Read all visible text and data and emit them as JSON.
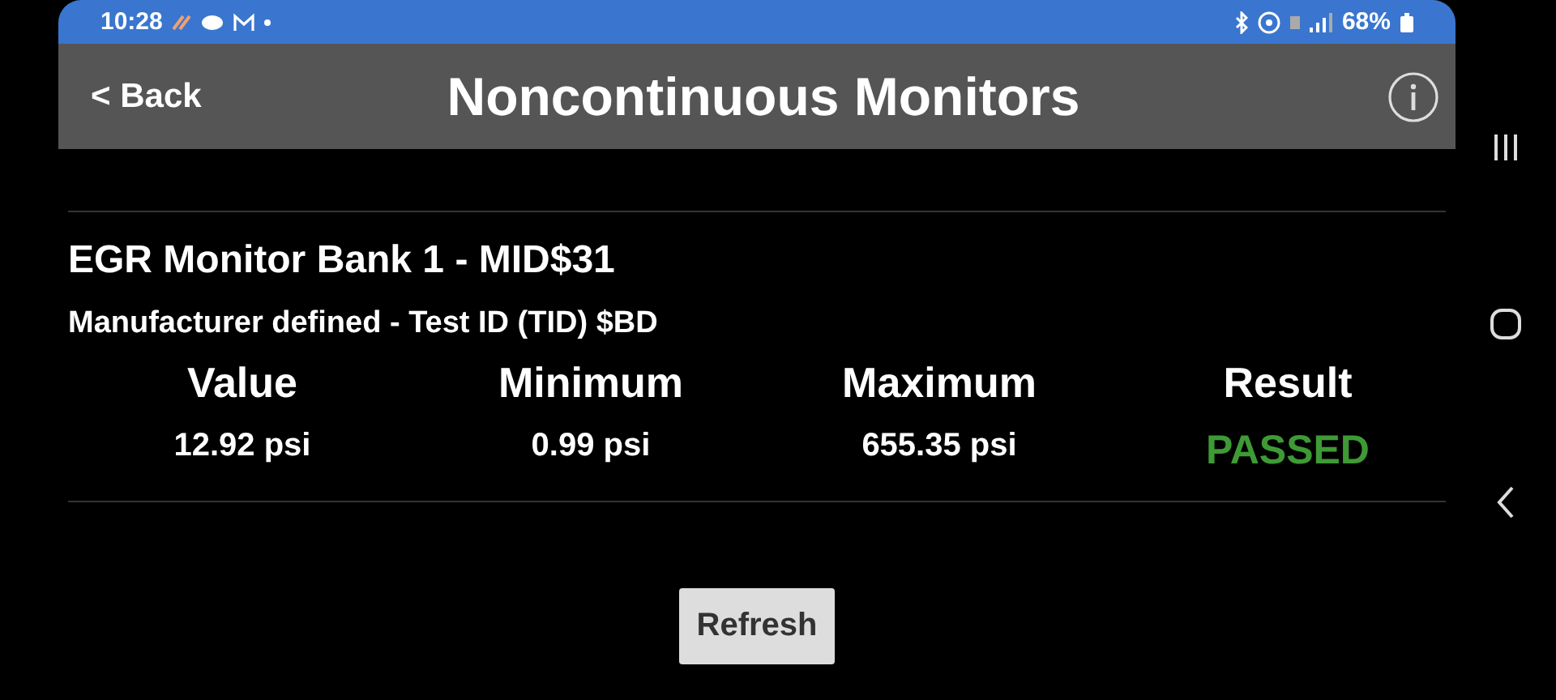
{
  "status_bar": {
    "time": "10:28",
    "battery": "68%"
  },
  "header": {
    "back": "< Back",
    "title": "Noncontinuous Monitors"
  },
  "monitor": {
    "title": "EGR Monitor Bank 1 - MID$31",
    "subtitle": "Manufacturer defined - Test ID (TID) $BD",
    "columns": [
      "Value",
      "Minimum",
      "Maximum",
      "Result"
    ],
    "cells": [
      {
        "text": "12.92 psi",
        "kind": "plain"
      },
      {
        "text": "0.99 psi",
        "kind": "plain"
      },
      {
        "text": "655.35 psi",
        "kind": "plain"
      },
      {
        "text": "PASSED",
        "kind": "result"
      }
    ]
  },
  "button": "Refresh"
}
